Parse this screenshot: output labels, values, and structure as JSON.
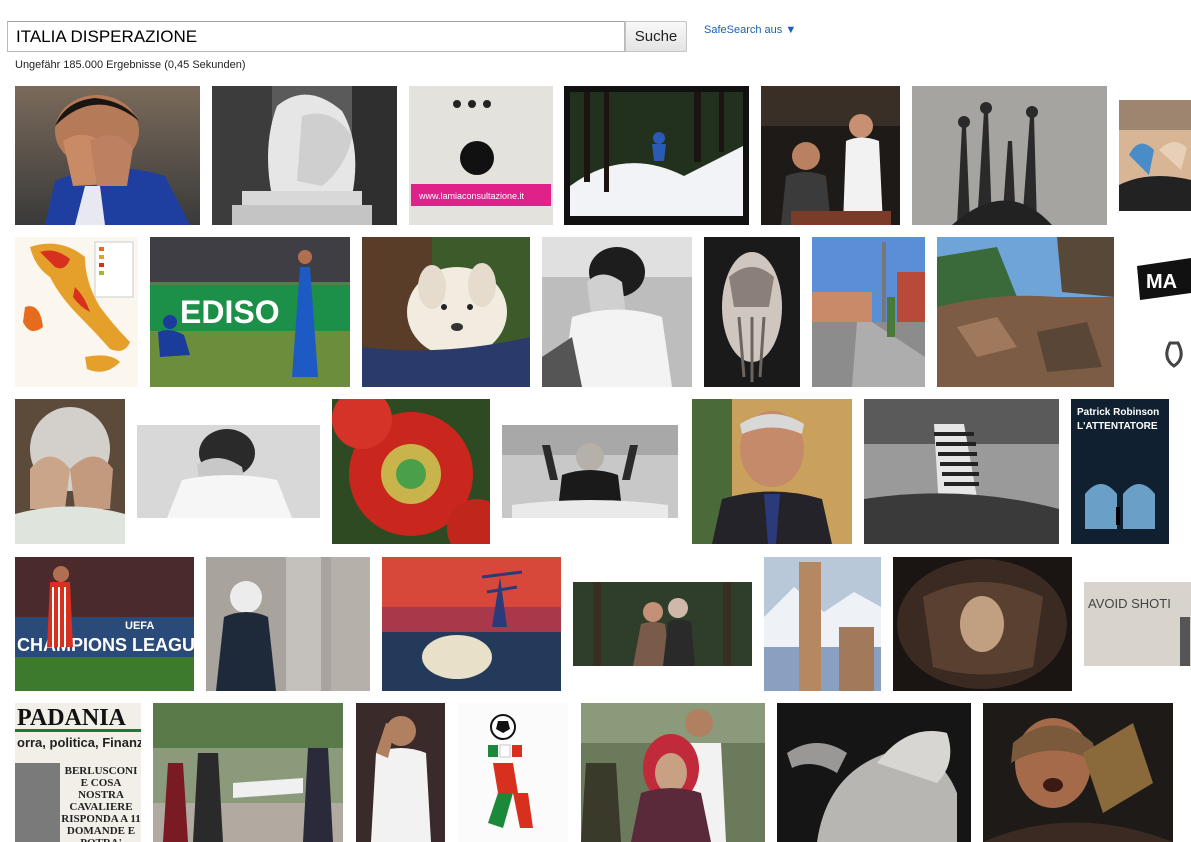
{
  "search": {
    "query": "ITALIA DISPERAZIONE",
    "button_label": "Suche",
    "safesearch_label": "SafeSearch aus ▼"
  },
  "results": {
    "stats": "Ungefähr 185.000 Ergebnisse (0,45 Sekunden)"
  },
  "thumbnails": {
    "crying-footballer": {
      "text": ""
    },
    "weeping-angel-statue": {
      "text": ""
    },
    "face-sticker": {
      "text": "www.lamiaconsultazione.it"
    },
    "skier-snow": {
      "text": ""
    },
    "restaurant-scene": {
      "text": ""
    },
    "hands-raised-sculpture": {
      "text": ""
    },
    "beach-people": {
      "text": ""
    },
    "italy-map": {
      "text": ""
    },
    "rugby-players": {
      "text": "EDISO"
    },
    "puppy": {
      "text": ""
    },
    "woman-covering-face": {
      "text": ""
    },
    "hands-over-face-drawing": {
      "text": ""
    },
    "city-street": {
      "text": ""
    },
    "earthquake-rubble": {
      "text": ""
    },
    "ma-sign": {
      "text": "MA"
    },
    "old-woman-hands-face": {
      "text": ""
    },
    "girl-hands-face": {
      "text": ""
    },
    "red-flowers": {
      "text": ""
    },
    "man-at-podium": {
      "text": ""
    },
    "man-in-suit": {
      "text": ""
    },
    "striped-shirt-man": {
      "text": ""
    },
    "book-cover": {
      "text": "Patrick Robinson",
      "text2": "L'ATTENTATORE"
    },
    "champions-league-player": {
      "text": "CHAMPIONS LEAGUE",
      "text2": "UEFA"
    },
    "woman-headscarf-wall": {
      "text": ""
    },
    "surreal-painting": {
      "text": ""
    },
    "couple-forest": {
      "text": ""
    },
    "church-tower": {
      "text": ""
    },
    "fisheye-building": {
      "text": ""
    },
    "avoid-shoti-wall": {
      "text": "AVOID SHOTI"
    },
    "padania-newspaper": {
      "text": "PADANIA",
      "text2": "orra, politica, Finanz",
      "text3": "BERLUSCONI E COSA NOSTRA CAVALIERE RISPONDA A 11 DOMANDE E POTRA' SCAGIONARSI"
    },
    "street-arrest": {
      "text": ""
    },
    "player-hands-face": {
      "text": ""
    },
    "italia90-mascot": {
      "text": ""
    },
    "crowd-woman-hijab": {
      "text": ""
    },
    "sculpture-bw": {
      "text": ""
    },
    "crying-woman": {
      "text": ""
    }
  },
  "colors": {
    "link_blue": "#1a5fb4",
    "text": "#222222",
    "border": "#b9b9b9"
  }
}
